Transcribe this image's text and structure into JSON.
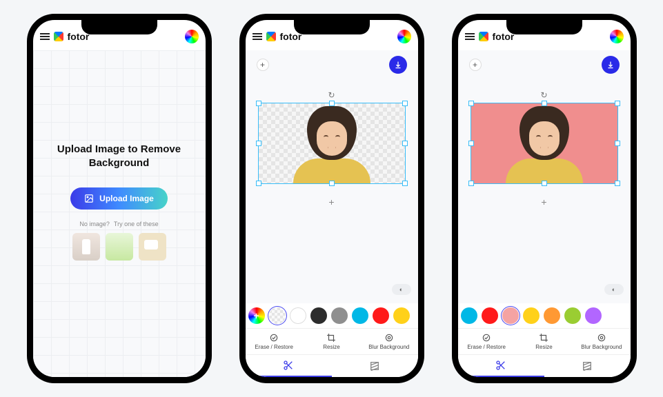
{
  "app": {
    "name": "fotor"
  },
  "upload_screen": {
    "title": "Upload Image to Remove Background",
    "button": "Upload Image",
    "no_image_q": "No image?",
    "try_label": "Try one of these"
  },
  "editor": {
    "tools": {
      "erase": "Erase / Restore",
      "resize": "Resize",
      "blur": "Blur Background"
    },
    "swatches_checker": [
      "rainbow",
      "transparent",
      "#ffffff",
      "#2d2d2d",
      "#8f8f8f",
      "#00b8e6",
      "#ff1a1a",
      "#ffd11a"
    ],
    "swatches_color": [
      "#00b8e6",
      "#ff1a1a",
      "#f5a3a3",
      "#ffd11a",
      "#ff9933",
      "#9acd32",
      "#b266ff"
    ],
    "selected_swatch_checker": 1,
    "selected_swatch_color": 2,
    "canvas_bg_color": "#f08e8e"
  }
}
